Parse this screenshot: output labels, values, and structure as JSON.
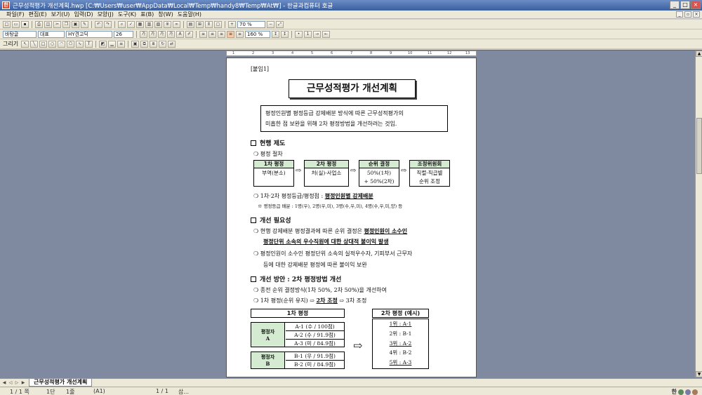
{
  "window": {
    "title": "근무성적평가 개선계획.hwp [C:₩Users₩user₩AppData₩Local₩Temp₩handy8₩Temp₩At₩] - 한글과컴퓨터 호글"
  },
  "menu": [
    "파일(F)",
    "편집(E)",
    "보기(U)",
    "입력(D)",
    "모양(J)",
    "도구(K)",
    "표(B)",
    "창(W)",
    "도움말(H)"
  ],
  "toolbar": {
    "zoom": "70 %",
    "style": "바탕글",
    "lang": "대표",
    "font": "HY견고딕",
    "size": "26",
    "line_spacing": "160 %",
    "draw_label": "그리기"
  },
  "document": {
    "attachment": "[붙임1]",
    "title": "근무성적평가 개선계획",
    "summary_line1": "평정인원별 평정등급 강제배분 방식에 따른 근무성적평가의",
    "summary_line2": "미흡한 점 보완을 위해 2차 평정방법을 개선하려는 것임.",
    "section1": "현행 제도",
    "s1_procedure": "❍ 평정 절차",
    "steps": [
      {
        "head": "1차 평정",
        "line1": "부역(분소)",
        "line2": ""
      },
      {
        "head": "2차 평정",
        "line1": "처(실)·사업소",
        "line2": ""
      },
      {
        "head": "순위 결정",
        "line1": "50%(1차)",
        "line2": "+ 50%(2차)"
      },
      {
        "head": "조정위원회",
        "line1": "직렬·직급별",
        "line2": "순위 조정"
      }
    ],
    "s1_grade_prefix": "❍ 1차·2차 평정등급/평정점 : ",
    "s1_grade_emph": "평정인원별 강제배분",
    "s1_note": "※ 평정등급 배분 : 1명(우), 2명(우,미), 3명(수,우,미), 4명(수,우,미,양) 등",
    "section2": "개선 필요성",
    "s2_line1_prefix": "❍ 현행 강제배분 평정결과에 따른 순위 결정은 ",
    "s2_line1_emph": "평정인원이 소수인",
    "s2_line2_emph": "평정단위 소속의 우수직원에 대한 상대적 불이익 발생",
    "s2_line3": "❍ 평정인원이 소수인 평정단위 소속의 실적우수자, 기피부서 근무자",
    "s2_line4": "등에 대한 강제배분 평정에 따른 불이익 보완",
    "section3": "개선 방안 : 2차 평정방법 개선",
    "s3_line1": "❍ 종전 순위 결정방식(1차 50%, 2차 50%)을 개선하여",
    "s3_line2_prefix": "❍ 1차 평정(순위 유지) ⇨ ",
    "s3_line2_emph": "2차 조정",
    "s3_line2_suffix": " ⇨ 3차 조정",
    "table_left_title": "1차 평정",
    "table_right_title": "2차 평정 (예시)",
    "group_a": {
      "label1": "평정자",
      "label2": "A",
      "rows": [
        "A-1 (수 / 100점)",
        "A-2 (수 / 91.9점)",
        "A-3 (미 / 84.9점)"
      ]
    },
    "group_b": {
      "label1": "평정자",
      "label2": "B",
      "rows": [
        "B-1 (우 / 91.9점)",
        "B-2 (미 / 84.9점)"
      ]
    },
    "results": [
      "1위 : A-1",
      "2위 : B-1",
      "3위 : A-2",
      "4위 : B-2",
      "5위 : A-3"
    ],
    "arrow": "⇨"
  },
  "tabs": {
    "doc_tab": "근무성적평가 개선계획"
  },
  "status": {
    "page": "1 / 1 쪽",
    "section": "1단",
    "line": "1줄",
    "cell": "(A1)",
    "page_of": "1 / 1",
    "ins": "삽..."
  }
}
